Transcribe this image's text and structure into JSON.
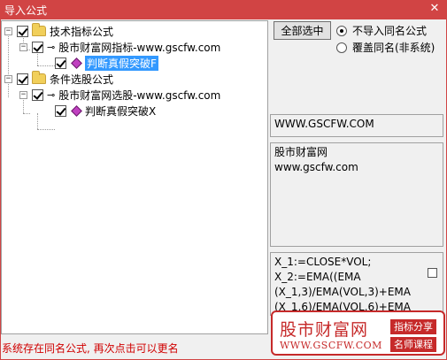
{
  "window": {
    "title": "导入公式",
    "close_glyph": "✕"
  },
  "tree": {
    "groups": [
      {
        "label": "技术指标公式",
        "checked": true,
        "children": [
          {
            "label": "股市财富网指标-www.gscfw.com",
            "checked": true,
            "children": [
              {
                "label": "判断真假突破F",
                "checked": true,
                "selected": true
              }
            ]
          }
        ]
      },
      {
        "label": "条件选股公式",
        "checked": true,
        "children": [
          {
            "label": "股市财富网选股-www.gscfw.com",
            "checked": true,
            "children": [
              {
                "label": "判断真假突破X",
                "checked": true,
                "selected": false
              }
            ]
          }
        ]
      }
    ]
  },
  "controls": {
    "select_all_label": "全部选中",
    "options": [
      {
        "label": "不导入同名公式",
        "selected": true
      },
      {
        "label": "覆盖同名(非系统)",
        "selected": false
      }
    ]
  },
  "url_box": {
    "text": "WWW.GSCFW.COM"
  },
  "info_box": {
    "line1": "股市财富网",
    "line2": "www.gscfw.com"
  },
  "code_box": {
    "lines": [
      "X_1:=CLOSE*VOL;",
      "X_2:=EMA((EMA",
      "(X_1,3)/EMA(VOL,3)+EMA",
      "(X_1,6)/EMA(VOL,6)+EMA"
    ]
  },
  "status": {
    "text": "系统存在同名公式, 再次点击可以更名"
  },
  "banner": {
    "name": "股市财富网",
    "site": "WWW.GSCFW.COM",
    "tag1": "指标分享",
    "tag2": "名师课程",
    "color": "#c62a2a"
  }
}
